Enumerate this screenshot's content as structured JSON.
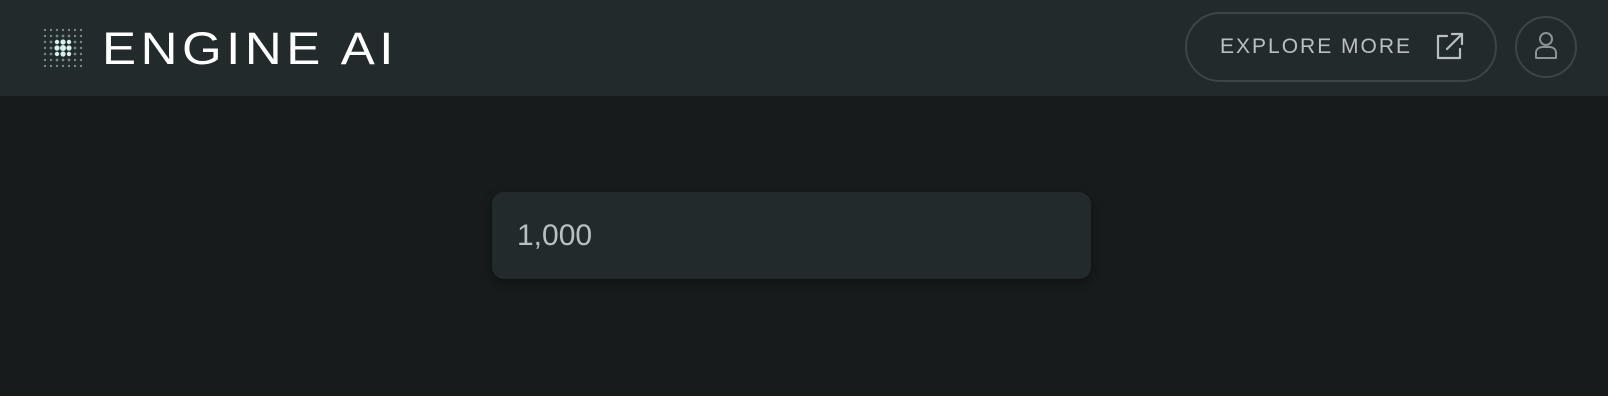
{
  "app": {
    "brand_name": "ENGINE AI"
  },
  "header": {
    "explore_label": "EXPLORE MORE",
    "explore_icon": "external-link-icon",
    "user_icon": "user-icon"
  },
  "main": {
    "field_value": "1,000"
  },
  "colors": {
    "page_background": "#171b1c",
    "header_background": "#232a2b",
    "field_background": "#232a2b",
    "border": "#3d4546",
    "text": "#b9c0c1",
    "wordmark": "#ffffff",
    "logo_accent": "#7fc4c4"
  }
}
